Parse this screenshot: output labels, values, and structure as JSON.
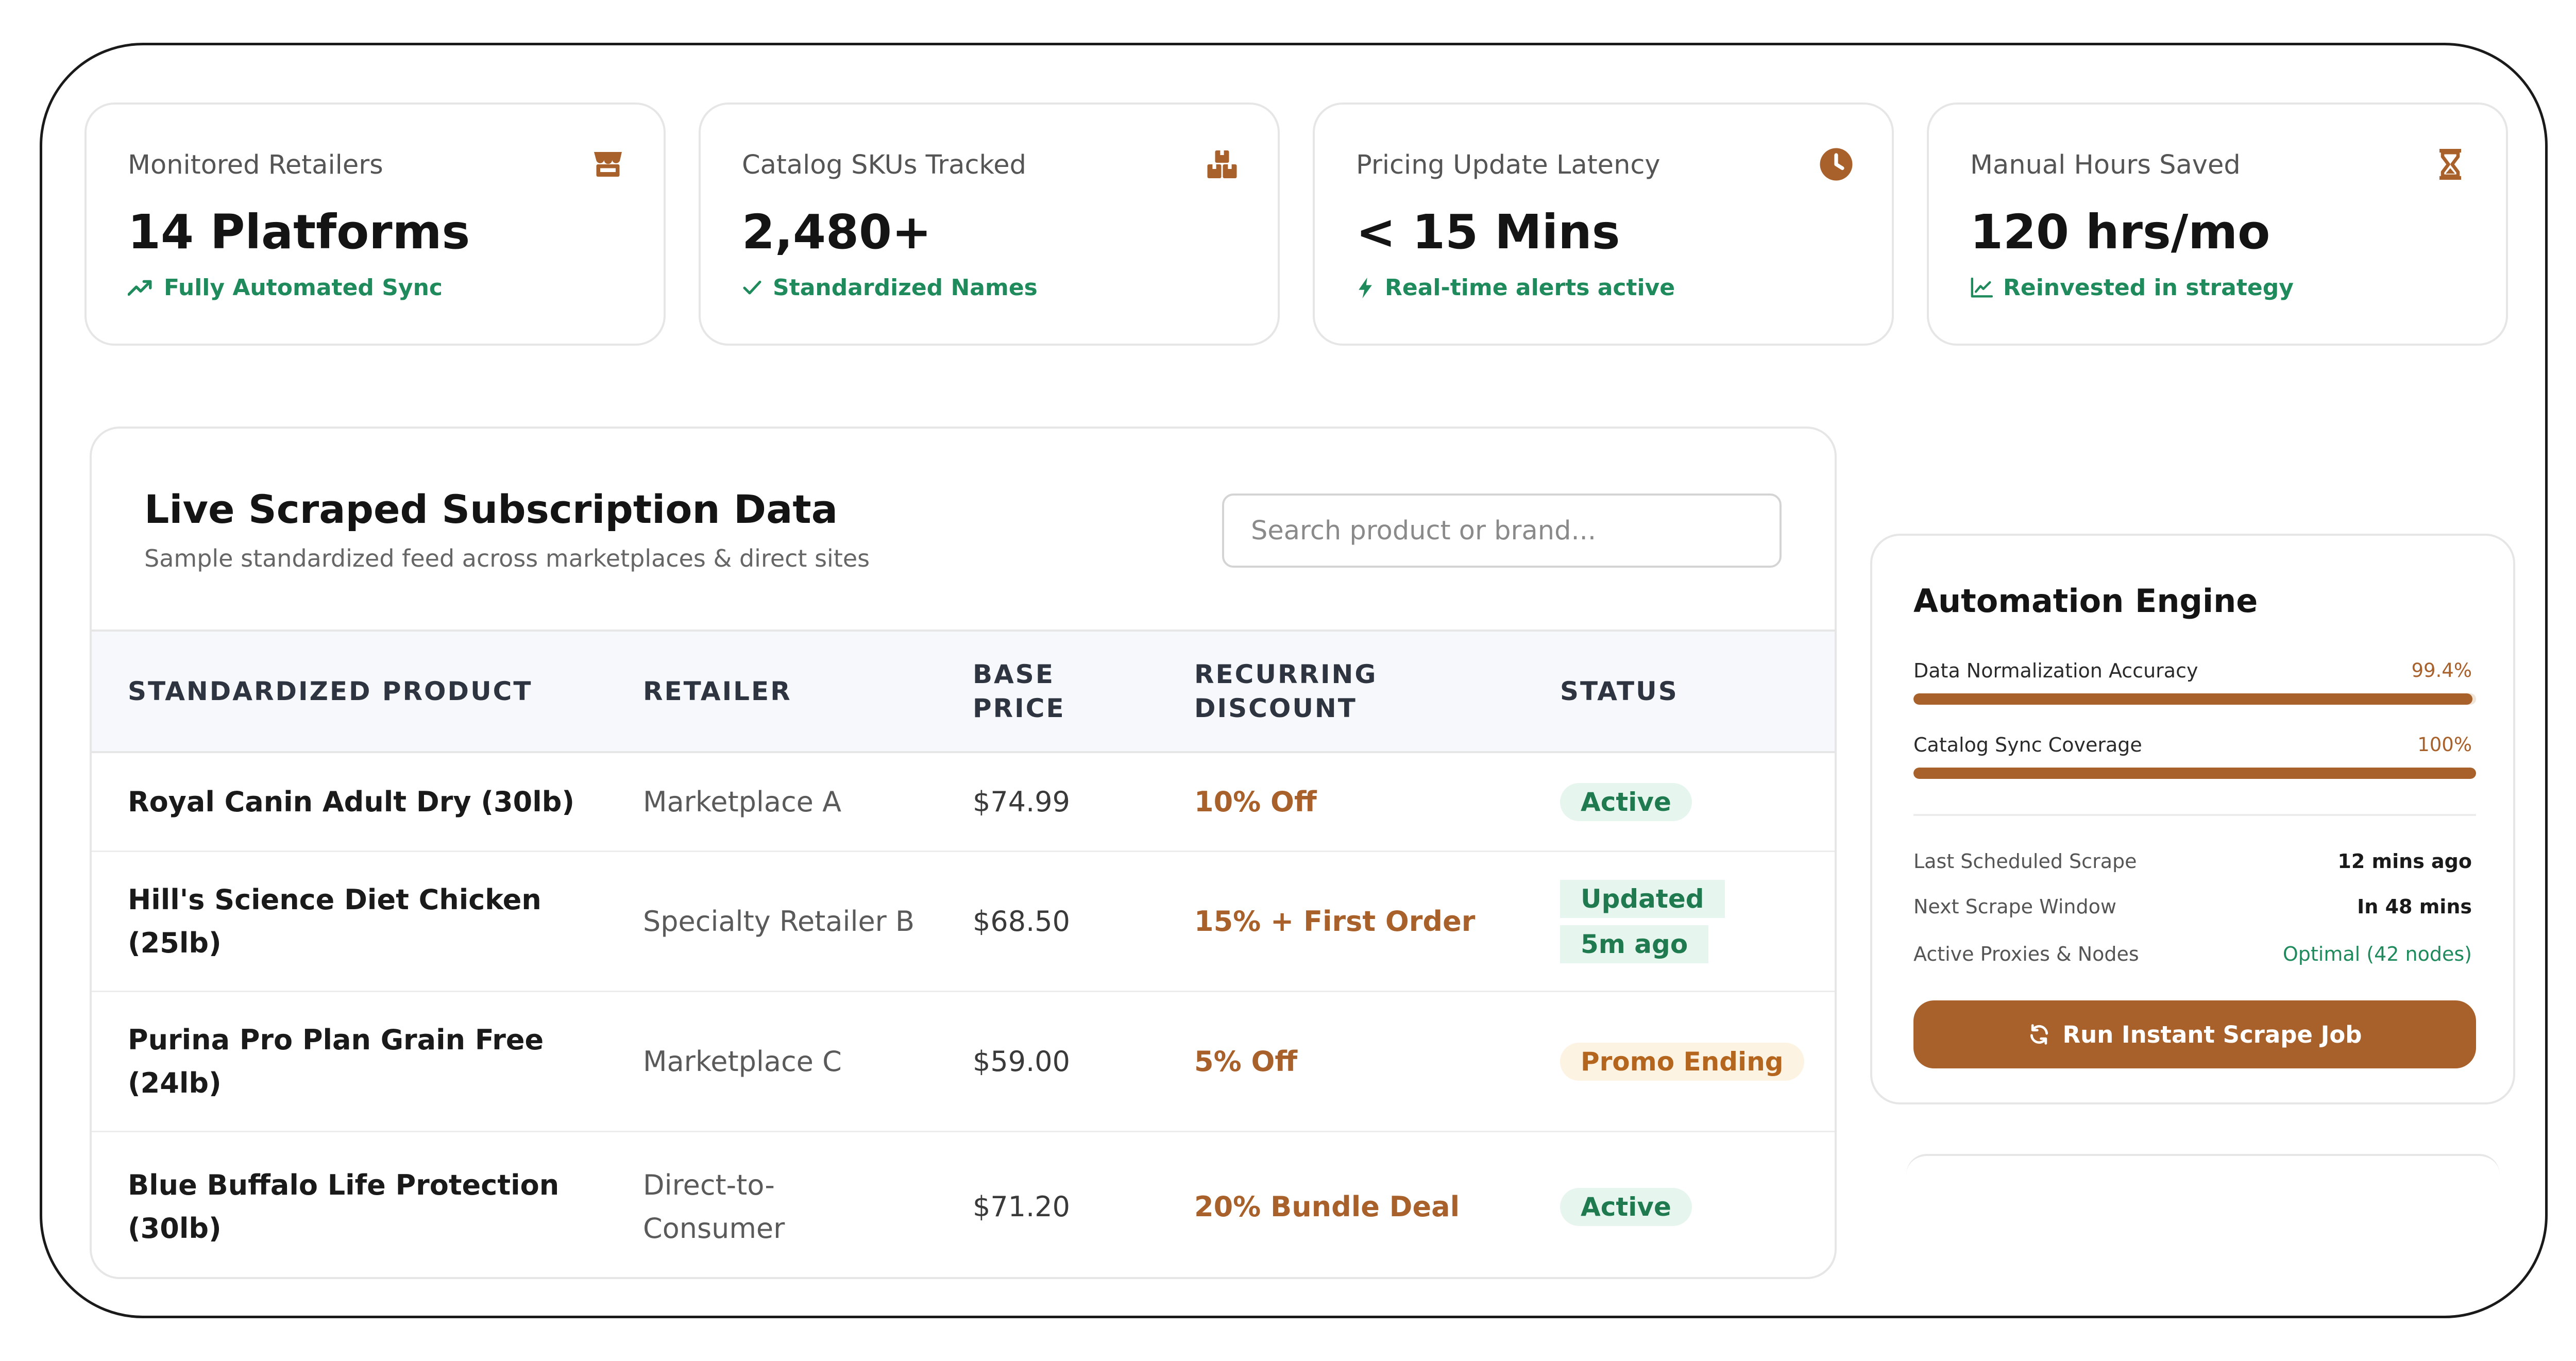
{
  "stats": [
    {
      "label": "Monitored Retailers",
      "value": "14 Platforms",
      "sub": "Fully Automated Sync",
      "icon": "store-icon",
      "sub_icon": "trending-up-icon"
    },
    {
      "label": "Catalog SKUs Tracked",
      "value": "2,480+",
      "sub": "Standardized Names",
      "icon": "boxes-icon",
      "sub_icon": "check-icon"
    },
    {
      "label": "Pricing Update Latency",
      "value": "< 15 Mins",
      "sub": "Real-time alerts active",
      "icon": "clock-icon",
      "sub_icon": "bolt-icon"
    },
    {
      "label": "Manual Hours Saved",
      "value": "120 hrs/mo",
      "sub": "Reinvested in strategy",
      "icon": "hourglass-icon",
      "sub_icon": "line-chart-icon"
    }
  ],
  "table_panel": {
    "title": "Live Scraped Subscription Data",
    "subtitle": "Sample standardized feed across marketplaces & direct sites",
    "search_placeholder": "Search product or brand...",
    "columns": [
      "STANDARDIZED PRODUCT",
      "RETAILER",
      "BASE PRICE",
      "RECURRING DISCOUNT",
      "STATUS"
    ],
    "rows": [
      {
        "product": "Royal Canin Adult Dry (30lb)",
        "retailer": "Marketplace A",
        "price": "$74.99",
        "discount": "10% Off",
        "status": "Active",
        "status_tone": "green"
      },
      {
        "product": "Hill's Science Diet Chicken (25lb)",
        "retailer": "Specialty Retailer B",
        "price": "$68.50",
        "discount": "15% + First Order",
        "status": "Updated 5m ago",
        "status_tone": "green"
      },
      {
        "product": "Purina Pro Plan Grain Free (24lb)",
        "retailer": "Marketplace C",
        "price": "$59.00",
        "discount": "5% Off",
        "status": "Promo Ending",
        "status_tone": "orange"
      },
      {
        "product": "Blue Buffalo Life Protection (30lb)",
        "retailer": "Direct-to-Consumer",
        "price": "$71.20",
        "discount": "20% Bundle Deal",
        "status": "Active",
        "status_tone": "green"
      }
    ]
  },
  "engine": {
    "title": "Automation Engine",
    "metrics": [
      {
        "label": "Data Normalization Accuracy",
        "value": "99.4%",
        "fraction": 0.994
      },
      {
        "label": "Catalog Sync Coverage",
        "value": "100%",
        "fraction": 1.0
      }
    ],
    "info": [
      {
        "label": "Last Scheduled Scrape",
        "value": "12 mins ago",
        "tone": "default"
      },
      {
        "label": "Next Scrape Window",
        "value": "In 48 mins",
        "tone": "default"
      },
      {
        "label": "Active Proxies & Nodes",
        "value": "Optimal (42 nodes)",
        "tone": "ok"
      }
    ],
    "button_label": "Run Instant Scrape Job",
    "button_icon": "refresh-icon"
  },
  "colors": {
    "accent": "#a9612b",
    "success": "#1f8a5c",
    "warning_bg": "#fdf3e2",
    "success_bg": "#e6f5ee"
  }
}
